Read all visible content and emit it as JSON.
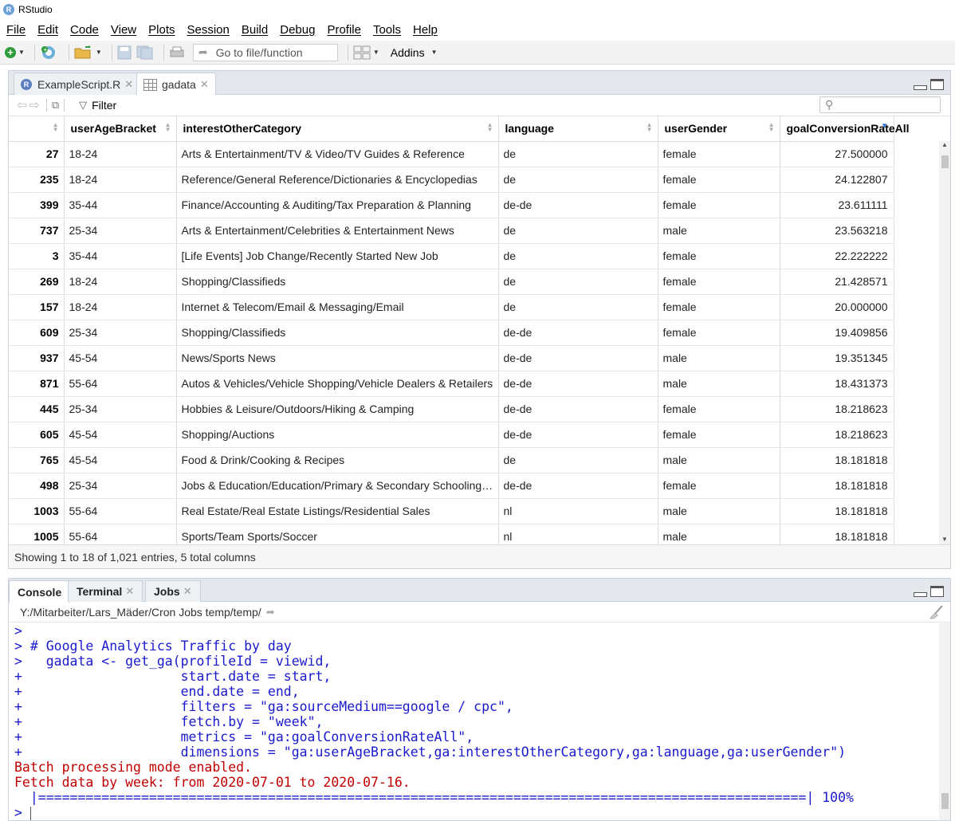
{
  "window": {
    "title": "RStudio"
  },
  "menu": [
    "File",
    "Edit",
    "Code",
    "View",
    "Plots",
    "Session",
    "Build",
    "Debug",
    "Profile",
    "Tools",
    "Help"
  ],
  "toolbar": {
    "goto_placeholder": "Go to file/function",
    "addins_label": "Addins"
  },
  "source_tabs": [
    {
      "label": "ExampleScript.R",
      "icon": "r-file-icon",
      "active": false
    },
    {
      "label": "gadata",
      "icon": "grid-icon",
      "active": true
    }
  ],
  "viewer": {
    "filter_label": "Filter",
    "search_value": ""
  },
  "table": {
    "columns": [
      "",
      "userAgeBracket",
      "interestOtherCategory",
      "language",
      "userGender",
      "goalConversionRateAll"
    ],
    "sorted_column": "goalConversionRateAll",
    "rows": [
      [
        "27",
        "18-24",
        "Arts & Entertainment/TV & Video/TV Guides & Reference",
        "de",
        "female",
        "27.500000"
      ],
      [
        "235",
        "18-24",
        "Reference/General Reference/Dictionaries & Encyclopedias",
        "de",
        "female",
        "24.122807"
      ],
      [
        "399",
        "35-44",
        "Finance/Accounting & Auditing/Tax Preparation & Planning",
        "de-de",
        "female",
        "23.611111"
      ],
      [
        "737",
        "25-34",
        "Arts & Entertainment/Celebrities & Entertainment News",
        "de",
        "male",
        "23.563218"
      ],
      [
        "3",
        "35-44",
        "[Life Events] Job Change/Recently Started New Job",
        "de",
        "female",
        "22.222222"
      ],
      [
        "269",
        "18-24",
        "Shopping/Classifieds",
        "de",
        "female",
        "21.428571"
      ],
      [
        "157",
        "18-24",
        "Internet & Telecom/Email & Messaging/Email",
        "de",
        "female",
        "20.000000"
      ],
      [
        "609",
        "25-34",
        "Shopping/Classifieds",
        "de-de",
        "female",
        "19.409856"
      ],
      [
        "937",
        "45-54",
        "News/Sports News",
        "de-de",
        "male",
        "19.351345"
      ],
      [
        "871",
        "55-64",
        "Autos & Vehicles/Vehicle Shopping/Vehicle Dealers & Retailers",
        "de-de",
        "male",
        "18.431373"
      ],
      [
        "445",
        "25-34",
        "Hobbies & Leisure/Outdoors/Hiking & Camping",
        "de-de",
        "female",
        "18.218623"
      ],
      [
        "605",
        "45-54",
        "Shopping/Auctions",
        "de-de",
        "female",
        "18.218623"
      ],
      [
        "765",
        "45-54",
        "Food & Drink/Cooking & Recipes",
        "de",
        "male",
        "18.181818"
      ],
      [
        "498",
        "25-34",
        "Jobs & Education/Education/Primary & Secondary Schooling (...",
        "de-de",
        "female",
        "18.181818"
      ],
      [
        "1003",
        "55-64",
        "Real Estate/Real Estate Listings/Residential Sales",
        "nl",
        "male",
        "18.181818"
      ],
      [
        "1005",
        "55-64",
        "Sports/Team Sports/Soccer",
        "nl",
        "male",
        "18.181818"
      ]
    ],
    "status": "Showing 1 to 18 of 1,021 entries, 5 total columns"
  },
  "console_tabs": [
    {
      "label": "Console",
      "closable": false,
      "active": true
    },
    {
      "label": "Terminal",
      "closable": true,
      "active": false
    },
    {
      "label": "Jobs",
      "closable": true,
      "active": false
    }
  ],
  "console": {
    "working_dir": "Y:/Mitarbeiter/Lars_Mäder/Cron Jobs temp/temp/",
    "lines": [
      {
        "prompt": ">",
        "text": "",
        "type": "code"
      },
      {
        "prompt": ">",
        "text": " # Google Analytics Traffic by day",
        "type": "code"
      },
      {
        "prompt": ">",
        "text": "   gadata <- get_ga(profileId = viewid,",
        "type": "code"
      },
      {
        "prompt": "+",
        "text": "                    start.date = start,",
        "type": "code"
      },
      {
        "prompt": "+",
        "text": "                    end.date = end,",
        "type": "code"
      },
      {
        "prompt": "+",
        "text": "                    filters = \"ga:sourceMedium==google / cpc\",",
        "type": "code"
      },
      {
        "prompt": "+",
        "text": "                    fetch.by = \"week\",",
        "type": "code"
      },
      {
        "prompt": "+",
        "text": "                    metrics = \"ga:goalConversionRateAll\",",
        "type": "code"
      },
      {
        "prompt": "+",
        "text": "                    dimensions = \"ga:userAgeBracket,ga:interestOtherCategory,ga:language,ga:userGender\")",
        "type": "code"
      },
      {
        "prompt": "",
        "text": "Batch processing mode enabled.",
        "type": "err"
      },
      {
        "prompt": "",
        "text": "Fetch data by week: from 2020-07-01 to 2020-07-16.",
        "type": "err"
      },
      {
        "prompt": "",
        "text": "  |=================================================================================================| 100%",
        "type": "prog"
      }
    ],
    "final_prompt": ">"
  }
}
